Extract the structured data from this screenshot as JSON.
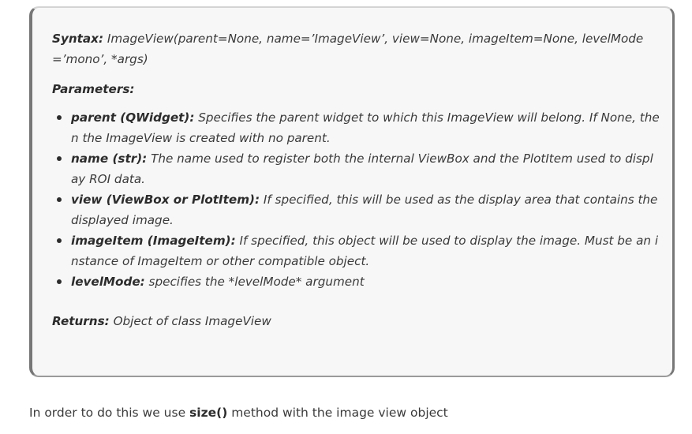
{
  "doc": {
    "syntax_label": "Syntax:",
    "syntax_text": "ImageView(parent=None, name=’ImageView’, view=None, imageItem=None, levelMode=’mono’, *args)",
    "parameters_label": "Parameters:",
    "parameters": [
      {
        "name": "parent (QWidget):",
        "description": "Specifies the parent widget to which this ImageView will belong. If None, then the ImageView is created with no parent."
      },
      {
        "name": "name (str):",
        "description": "The name used to register both the internal ViewBox and the PlotItem used to display ROI data."
      },
      {
        "name": "view (ViewBox or PlotItem):",
        "description": "If specified, this will be used as the display area that contains the displayed image."
      },
      {
        "name": "imageItem (ImageItem):",
        "description": "If specified, this object will be used to display the image. Must be an instance of ImageItem or other compatible object."
      },
      {
        "name": "levelMode:",
        "description": "specifies the *levelMode* argument"
      }
    ],
    "returns_label": "Returns:",
    "returns_text": "Object of class ImageView"
  },
  "after": {
    "text_before": "In order to do this we use ",
    "method": "size()",
    "text_after": " method with the image view object"
  }
}
